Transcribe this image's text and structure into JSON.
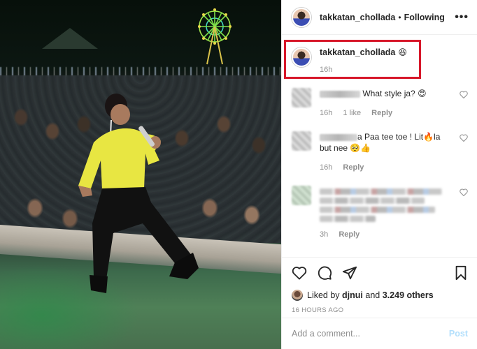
{
  "post": {
    "username": "takkatan_chollada",
    "follow_status": "Following",
    "more_label": "•••"
  },
  "caption": {
    "username": "takkatan_chollada",
    "emoji": "😆",
    "time": "16h"
  },
  "comments": [
    {
      "text": "What style ja?",
      "emoji": "😍",
      "time": "16h",
      "likes": "1 like",
      "reply": "Reply"
    },
    {
      "text_line1": "a Paa tee toe ! Lit",
      "emoji1": "🔥",
      "text_line1_tail": "la",
      "text_line2": "but nee",
      "emoji2": "🥺",
      "emoji3": "👍",
      "time": "16h",
      "reply": "Reply"
    },
    {
      "time": "3h",
      "reply": "Reply"
    }
  ],
  "likes": {
    "prefix": "Liked by",
    "user": "djnui",
    "conj": "and",
    "count": "3.249 others"
  },
  "timestamp": "16 HOURS AGO",
  "add_comment": {
    "placeholder": "Add a comment...",
    "post_label": "Post"
  },
  "colors": {
    "highlight": "#d7182a",
    "post_button": "#b2dffc",
    "shirt": "#e8e642"
  }
}
